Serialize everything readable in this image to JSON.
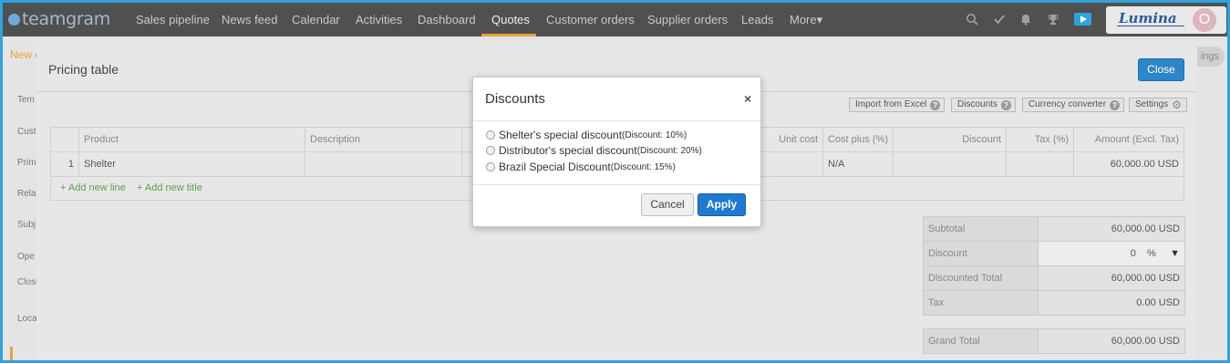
{
  "app": {
    "logo": "teamgram"
  },
  "nav": {
    "items": [
      "Sales pipeline",
      "News feed",
      "Calendar",
      "Activities",
      "Dashboard",
      "Quotes",
      "Customer orders",
      "Supplier orders",
      "Leads",
      "More▾"
    ],
    "active": "Quotes",
    "brand": "Lumina",
    "avatar_initial": "O"
  },
  "background": {
    "new_label": "New q",
    "settings_label": "ings",
    "side_labels": [
      "Tem",
      "Cust",
      "Prim",
      "Rela",
      "Subj",
      "Ope",
      "Closi",
      "Loca"
    ]
  },
  "pricing": {
    "title": "Pricing table",
    "close_label": "Close",
    "toolbar": {
      "import": "Import from Excel",
      "discounts": "Discounts",
      "currency": "Currency converter",
      "settings": "Settings"
    },
    "columns": [
      "",
      "Product",
      "Description",
      "",
      "Unit cost",
      "Cost plus (%)",
      "Discount",
      "Tax (%)",
      "Amount (Excl. Tax)"
    ],
    "rows": [
      {
        "num": "1",
        "product": "Shelter",
        "description": "",
        "unit_cost": "",
        "cost_plus": "N/A",
        "discount": "",
        "tax": "",
        "amount": "60,000.00 USD"
      }
    ],
    "add_line": "+ Add new line",
    "add_title": "+ Add new title",
    "summary": {
      "subtotal_label": "Subtotal",
      "subtotal": "60,000.00 USD",
      "discount_label": "Discount",
      "discount_value": "0",
      "discount_unit": "%",
      "discounted_label": "Discounted Total",
      "discounted": "60,000.00 USD",
      "tax_label": "Tax",
      "tax": "0.00 USD",
      "grand_label": "Grand Total",
      "grand": "60,000.00 USD"
    }
  },
  "dialog": {
    "title": "Discounts",
    "close_symbol": "×",
    "options": [
      {
        "name": "Shelter's special discount",
        "discount": "(Discount: 10%)"
      },
      {
        "name": "Distributor's special discount",
        "discount": "(Discount: 20%)"
      },
      {
        "name": "Brazil Special Discount",
        "discount": "(Discount: 15%)"
      }
    ],
    "cancel_label": "Cancel",
    "apply_label": "Apply"
  },
  "colors": {
    "accent": "#2ea3dc",
    "primary_button": "#1f7ad2",
    "active_tab": "#e8a33c",
    "add_link": "#5aa24a"
  }
}
